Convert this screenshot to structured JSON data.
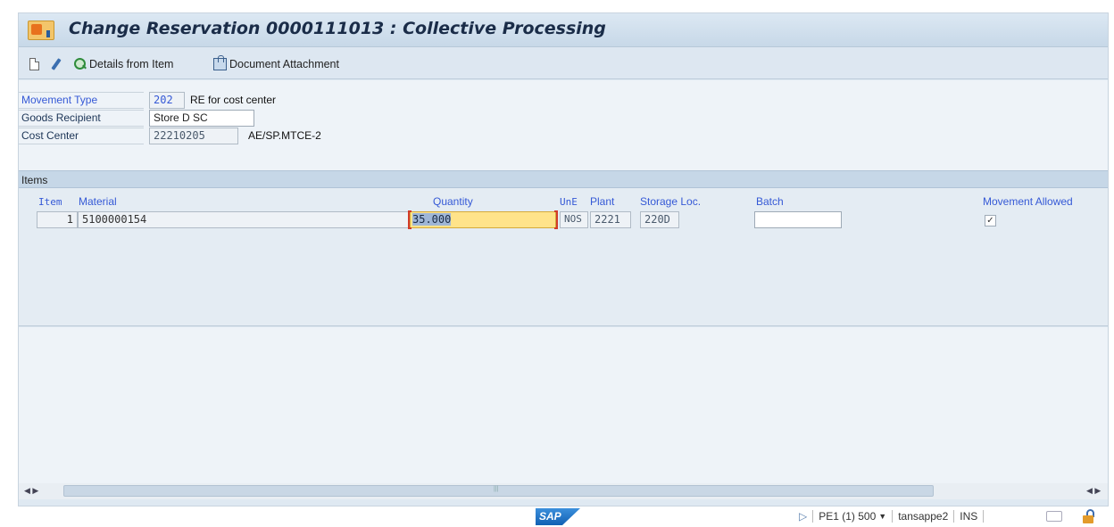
{
  "window": {
    "title": "Change Reservation 0000111013 : Collective Processing"
  },
  "toolbar": {
    "create_icon": "new-document-icon",
    "edit_icon": "pencil-icon",
    "details_label": "Details from Item",
    "details_icon": "magnifier-icon",
    "attachment_label": "Document Attachment",
    "attachment_icon": "attachment-icon"
  },
  "header": {
    "movement_type": {
      "label": "Movement Type",
      "code": "202",
      "text": "RE for cost center"
    },
    "goods_recipient": {
      "label": "Goods Recipient",
      "value": "Store D SC"
    },
    "cost_center": {
      "label": "Cost Center",
      "value": "22210205",
      "text": "AE/SP.MTCE-2"
    }
  },
  "items": {
    "section_title": "Items",
    "columns": {
      "item": "Item",
      "material": "Material",
      "quantity": "Quantity",
      "unit": "UnE",
      "plant": "Plant",
      "storage_loc": "Storage Loc.",
      "batch": "Batch",
      "movement_allowed": "Movement Allowed"
    },
    "rows": [
      {
        "item": "1",
        "material": "5100000154",
        "quantity": "35.000",
        "unit": "NOS",
        "plant": "2221",
        "storage_loc": "220D",
        "batch": "",
        "movement_allowed": "✓"
      }
    ]
  },
  "scrollbar": {
    "left_arrows": "◀ ▶",
    "right_arrows": "◀ ▶"
  },
  "statusbar": {
    "logo": "SAP",
    "play_glyph": "▷",
    "system": "PE1 (1) 500",
    "dropdown_glyph": "▼",
    "user": "tansappe2",
    "mode": "INS"
  },
  "colors": {
    "accent_blue": "#3559d6",
    "active_field": "#ffe38a",
    "header_bg": "#c7d8e8"
  }
}
